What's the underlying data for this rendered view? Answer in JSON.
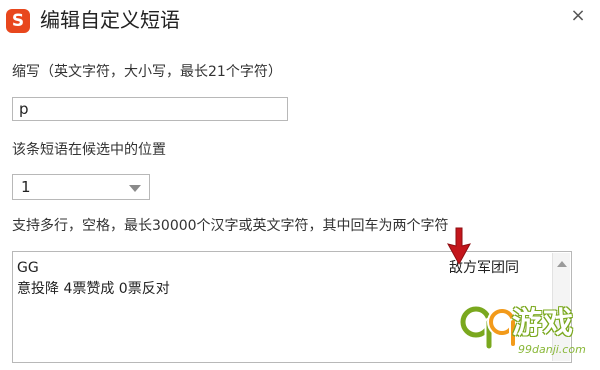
{
  "dialog": {
    "logo_letter": "S",
    "title": "编辑自定义短语",
    "close_glyph": "×"
  },
  "abbreviation": {
    "label": "缩写（英文字符，大小写，最长21个字符）",
    "value": "p"
  },
  "position": {
    "label": "该条短语在候选中的位置",
    "selected": "1"
  },
  "phrase": {
    "label": "支持多行，空格，最长30000个汉字或英文字符，其中回车为两个字符",
    "line1": "GG",
    "line1_right": "敌方军团同",
    "line2": "意投降 4票赞成 0票反对"
  },
  "watermark": {
    "text": "游戏",
    "url": "99danji.com"
  },
  "colors": {
    "logo": "#e8471d",
    "annotation_arrow": "#c4161c",
    "watermark_green": "#7aa81e"
  },
  "icons": {
    "close": "close-icon",
    "dropdown": "chevron-down-icon",
    "scroll_up": "scroll-up-icon",
    "annotation": "red-arrow-icon"
  }
}
